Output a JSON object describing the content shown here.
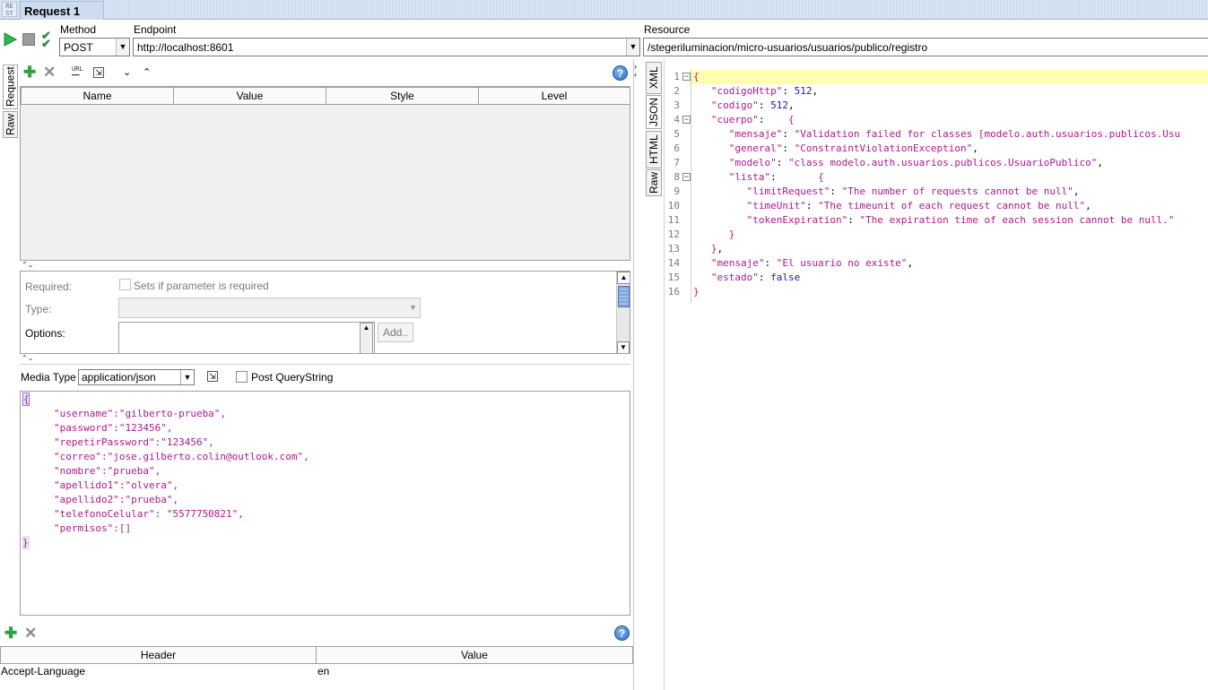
{
  "window": {
    "logo": "RE ST",
    "tab_title": "Request 1"
  },
  "toolbar": {
    "method_label": "Method",
    "method_value": "POST",
    "endpoint_label": "Endpoint",
    "endpoint_value": "http://localhost:8601",
    "resource_label": "Resource",
    "resource_value": "/stegeriluminacion/micro-usuarios/usuarios/publico/registro"
  },
  "left_tabs": [
    "Request",
    "Raw"
  ],
  "params": {
    "columns": [
      "Name",
      "Value",
      "Style",
      "Level"
    ]
  },
  "props": {
    "required_label": "Required:",
    "required_hint": "Sets if parameter is required",
    "type_label": "Type:",
    "options_label": "Options:",
    "add_button": "Add.."
  },
  "media": {
    "label": "Media Type",
    "value": "application/json",
    "post_qs_label": "Post QueryString"
  },
  "request_body": {
    "open": "{",
    "lines": [
      "\"username\":\"gilberto-prueba\",",
      "\"password\":\"123456\",",
      "\"repetirPassword\":\"123456\",",
      "\"correo\":\"jose.gilberto.colin@outlook.com\",",
      "\"nombre\":\"prueba\",",
      "\"apellido1\":\"olvera\",",
      "\"apellido2\":\"prueba\",",
      "\"telefonoCelular\": \"5577750821\",",
      "\"permisos\":[]"
    ],
    "close": "}"
  },
  "headers": {
    "columns": [
      "Header",
      "Value"
    ],
    "rows": [
      {
        "header": "Accept-Language",
        "value": "en"
      }
    ]
  },
  "response_tabs": [
    "XML",
    "JSON",
    "HTML",
    "Raw"
  ],
  "response": {
    "line_numbers": [
      "1",
      "2",
      "3",
      "4",
      "5",
      "6",
      "7",
      "8",
      "9",
      "10",
      "11",
      "12",
      "13",
      "14",
      "15",
      "16"
    ],
    "lines": [
      "{",
      "   \"codigoHttp\": 512,",
      "   \"codigo\": 512,",
      "   \"cuerpo\":    {",
      "      \"mensaje\": \"Validation failed for classes [modelo.auth.usuarios.publicos.Usu",
      "      \"general\": \"ConstraintViolationException\",",
      "      \"modelo\": \"class modelo.auth.usuarios.publicos.UsuarioPublico\",",
      "      \"lista\":       {",
      "         \"limitRequest\": \"The number of requests cannot be null\",",
      "         \"timeUnit\": \"The timeunit of each request cannot be null\",",
      "         \"tokenExpiration\": \"The expiration time of each session cannot be null.\"",
      "      }",
      "   },",
      "   \"mensaje\": \"El usuario no existe\",",
      "   \"estado\": false",
      "}"
    ]
  },
  "colors": {
    "highlight_line": "#ffffb0",
    "json_key": "#b0188f",
    "json_number": "#1a1ab8"
  }
}
